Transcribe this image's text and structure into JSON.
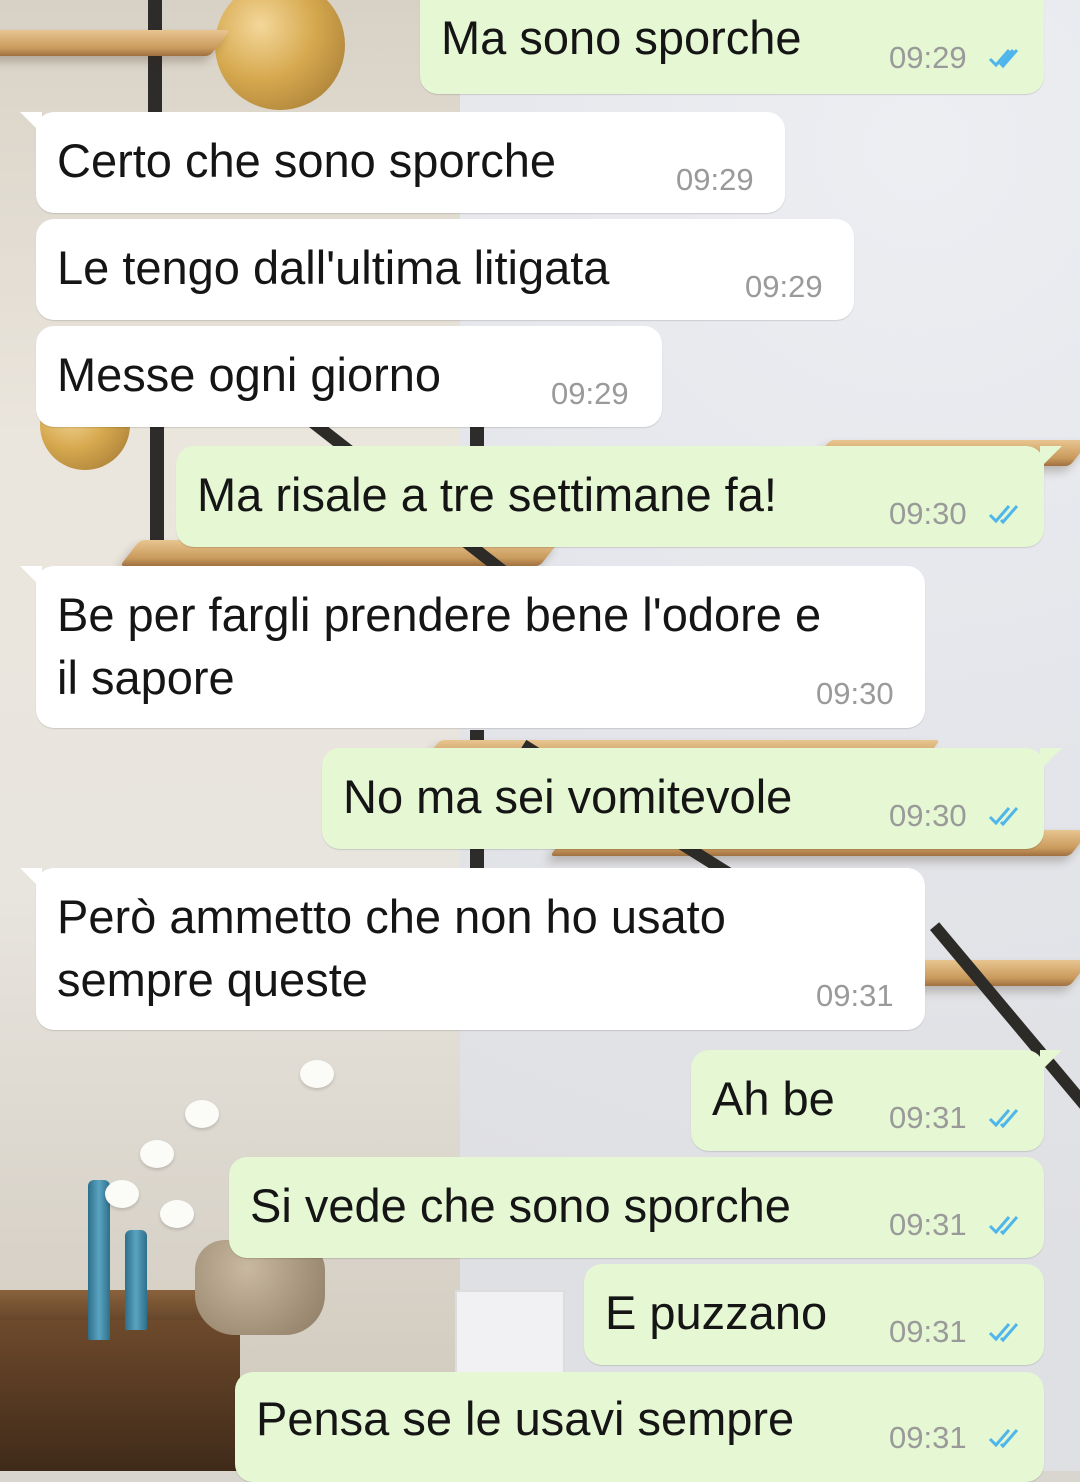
{
  "colors": {
    "incoming_bubble": "#ffffff",
    "outgoing_bubble": "#e5f7d3",
    "text": "#151515",
    "timestamp": "#9a9a9a",
    "read_ticks": "#4fb6ec"
  },
  "messages": [
    {
      "direction": "out",
      "text": "Ma sono sporche",
      "time": "09:29",
      "status": "read-double-tick-icon"
    },
    {
      "direction": "in",
      "text": "Certo che sono sporche",
      "time": "09:29"
    },
    {
      "direction": "in",
      "text": "Le tengo dall'ultima litigata",
      "time": "09:29"
    },
    {
      "direction": "in",
      "text": "Messe ogni giorno",
      "time": "09:29"
    },
    {
      "direction": "out",
      "text": "Ma risale a tre settimane fa!",
      "time": "09:30",
      "status": "read-double-tick-icon"
    },
    {
      "direction": "in",
      "text": "Be per fargli prendere bene l'odore e\nil sapore",
      "time": "09:30"
    },
    {
      "direction": "out",
      "text": "No ma sei vomitevole",
      "time": "09:30",
      "status": "read-double-tick-icon"
    },
    {
      "direction": "in",
      "text": "Però ammetto che non ho usato\nsempre queste",
      "time": "09:31"
    },
    {
      "direction": "out",
      "text": "Ah be",
      "time": "09:31",
      "status": "read-double-tick-icon"
    },
    {
      "direction": "out",
      "text": "Si vede che sono sporche",
      "time": "09:31",
      "status": "read-double-tick-icon"
    },
    {
      "direction": "out",
      "text": "E puzzano",
      "time": "09:31",
      "status": "read-double-tick-icon"
    },
    {
      "direction": "out",
      "text": "Pensa se le usavi sempre",
      "time": "09:31",
      "status": "read-double-tick-icon"
    }
  ]
}
